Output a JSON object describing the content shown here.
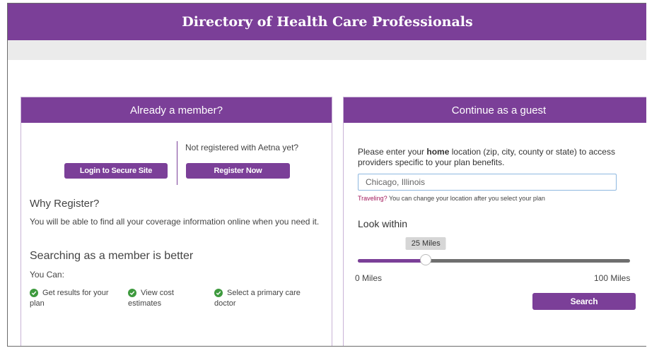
{
  "header": {
    "title": "Directory of Health Care Professionals"
  },
  "colors": {
    "brand": "#7b3f98",
    "check": "#3e9a3e"
  },
  "member_panel": {
    "title": "Already a member?",
    "login_button": "Login to Secure Site",
    "not_registered_text": "Not registered with Aetna yet?",
    "register_button": "Register Now",
    "why_register_heading": "Why Register?",
    "why_register_text": "You will be able to find all your coverage information online when you need it.",
    "better_heading": "Searching as a member is better",
    "you_can": "You Can:",
    "benefits": [
      {
        "icon": "check-circle-icon",
        "text": "Get results for your plan"
      },
      {
        "icon": "check-circle-icon",
        "text": "View cost estimates"
      },
      {
        "icon": "check-circle-icon",
        "text": "Select a primary care doctor"
      }
    ]
  },
  "guest_panel": {
    "title": "Continue as a guest",
    "instruction_prefix": "Please enter your ",
    "instruction_bold": "home",
    "instruction_suffix": " location (zip, city, county or state) to access providers specific to your plan benefits.",
    "location_value": "Chicago, Illinois",
    "traveling_link": "Traveling?",
    "traveling_text": " You can change your location after you select your plan",
    "look_within_label": "Look within",
    "slider": {
      "value_label": "25 Miles",
      "value": 25,
      "min": 0,
      "max": 100,
      "min_label": "0 Miles",
      "max_label": "100 Miles"
    },
    "search_button": "Search"
  }
}
